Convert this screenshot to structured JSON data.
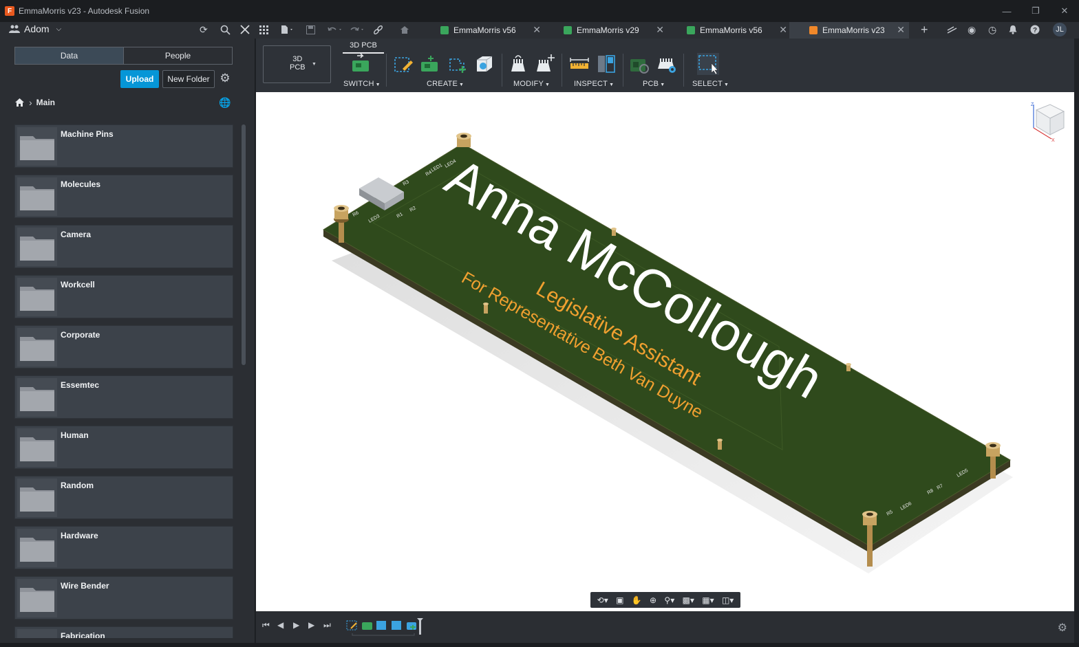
{
  "window": {
    "title": "EmmaMorris v23 - Autodesk Fusion",
    "app_icon_letter": "F"
  },
  "topnav": {
    "team_name": "Adom",
    "user_initials": "JL",
    "tabs": [
      {
        "label": "EmmaMorris v56",
        "icon_color": "#3aa65c",
        "icon": "pcb-icon"
      },
      {
        "label": "EmmaMorris v29",
        "icon_color": "#3aa65c",
        "icon": "schematic-icon"
      },
      {
        "label": "EmmaMorris v56",
        "icon_color": "#3aa65c",
        "icon": "pcb-icon"
      },
      {
        "label": "EmmaMorris v23",
        "icon_color": "#f0882a",
        "icon": "3d-pcb-icon",
        "active": true
      }
    ]
  },
  "data_panel": {
    "tabs": {
      "data": "Data",
      "people": "People"
    },
    "upload_label": "Upload",
    "new_folder_label": "New Folder",
    "breadcrumb": "Main",
    "folders": [
      "Machine Pins",
      "Molecules",
      "Camera",
      "Workcell",
      "Corporate",
      "Essemtec",
      "Human",
      "Random",
      "Hardware",
      "Wire Bender",
      "Fabrication"
    ]
  },
  "toolbar": {
    "workspace_line1": "3D",
    "workspace_line2": "PCB",
    "active_tab": "3D PCB",
    "groups": [
      "SWITCH",
      "CREATE",
      "MODIFY",
      "INSPECT",
      "PCB",
      "SELECT"
    ]
  },
  "board": {
    "name": "Anna McCollough",
    "title": "Legislative Assistant",
    "subtitle": "For Representative Beth Van Duyne",
    "silkscreen_labels": [
      "R6",
      "LED3",
      "R1",
      "R2",
      "R3",
      "R4",
      "LED1",
      "LED4",
      "R5",
      "LED6",
      "R8",
      "R7",
      "LED5"
    ]
  },
  "colors": {
    "accent": "#0696d7",
    "pcb_green": "#2f4a1c",
    "silk_white": "#ffffff",
    "silk_orange": "#f0a030",
    "brass": "#c7a360"
  }
}
